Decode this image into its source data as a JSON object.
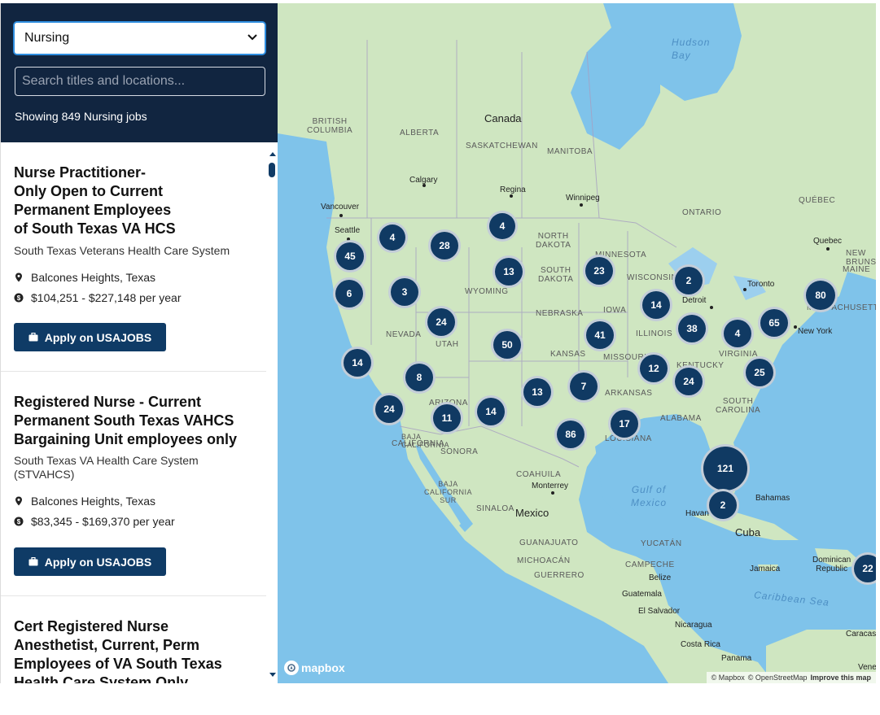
{
  "filters": {
    "category": "Nursing",
    "search_placeholder": "Search titles and locations...",
    "showing_text": "Showing 849 Nursing jobs"
  },
  "jobs": [
    {
      "title": "Nurse Practitioner-\nOnly Open to Current\nPermanent Employees\nof South Texas VA HCS",
      "org": "South Texas Veterans Health Care System",
      "location": "Balcones Heights, Texas",
      "pay": "$104,251 - $227,148 per year",
      "apply": "Apply on USAJOBS"
    },
    {
      "title": "Registered Nurse - Current\nPermanent South Texas VAHCS\nBargaining Unit employees only",
      "org": "South Texas VA Health Care System\n(STVAHCS)",
      "location": "Balcones Heights, Texas",
      "pay": "$83,345 - $169,370 per year",
      "apply": "Apply on USAJOBS"
    },
    {
      "title": "Cert Registered Nurse\nAnesthetist, Current, Perm\nEmployees of VA South Texas\nHealth Care System Only"
    }
  ],
  "map": {
    "clusters": [
      "4",
      "28",
      "4",
      "45",
      "13",
      "23",
      "2",
      "6",
      "3",
      "80",
      "14",
      "24",
      "50",
      "41",
      "38",
      "4",
      "65",
      "14",
      "8",
      "12",
      "24",
      "25",
      "7",
      "13",
      "14",
      "11",
      "24",
      "17",
      "86",
      "121",
      "2",
      "22"
    ],
    "labels": {
      "canada": "Canada",
      "mexico": "Mexico",
      "cuba": "Cuba",
      "hudson_bay": "Hudson\nBay",
      "gulf": "Gulf of\nMexico",
      "caribbean": "Caribbean Sea",
      "british_columbia": "BRITISH\nCOLUMBIA",
      "alberta": "ALBERTA",
      "saskatchewan": "SASKATCHEWAN",
      "manitoba": "MANITOBA",
      "ontario": "ONTARIO",
      "quebec_prov": "QUÉBEC",
      "new_brunswick": "NEW\nBRUNSW",
      "north_dakota": "NORTH\nDAKOTA",
      "south_dakota": "SOUTH\nDAKOTA",
      "minnesota": "MINNESOTA",
      "wisconsin": "WISCONSIN",
      "wyoming": "WYOMING",
      "nebraska": "NEBRASKA",
      "iowa": "IOWA",
      "illinois": "ILLINOIS",
      "nevada": "NEVADA",
      "utah": "UTAH",
      "kansas": "KANSAS",
      "missouri": "MISSOURI",
      "kentucky": "KENTUCKY",
      "virginia": "VIRGINIA",
      "arkansas": "ARKANSAS",
      "arizona": "ARIZONA",
      "california": "CALIFORNIA",
      "louisiana": "LOUISIANA",
      "alabama": "ALABAMA",
      "south_carolina": "SOUTH\nCAROLINA",
      "sonora": "SONORA",
      "coahuila": "COAHUILA",
      "baja_california": "BAJA\nCALIFORNIA",
      "baja_california_sur": "BAJA\nCALIFORNIA\nSUR",
      "sinaloa": "SINALOA",
      "guanajuato": "GUANAJUATO",
      "michoacan": "MICHOACÁN",
      "guerrero": "GUERRERO",
      "yucatan": "YUCATÁN",
      "campeche": "CAMPECHE",
      "maine": "MAINE",
      "massachusetts": "MASSACHUSETTS",
      "calgary": "Calgary",
      "regina": "Regina",
      "winnipeg": "Winnipeg",
      "vancouver": "Vancouver",
      "seattle": "Seattle",
      "toronto": "Toronto",
      "quebec_city": "Quebec",
      "detroit": "Detroit",
      "new_york": "New York",
      "monterrey": "Monterrey",
      "havana": "Havan",
      "bahamas": "Bahamas",
      "jamaica": "Jamaica",
      "dominican": "Dominican\nRepublic",
      "belize": "Belize",
      "guatemala": "Guatemala",
      "el_salvador": "El Salvador",
      "nicaragua": "Nicaragua",
      "costa_rica": "Costa Rica",
      "panama": "Panama",
      "caracas": "Caracas",
      "venez": "Venez"
    },
    "logo": "mapbox",
    "attribution": {
      "mapbox": "© Mapbox",
      "osm": "© OpenStreetMap",
      "improve": "Improve this map"
    },
    "colors": {
      "water": "#7fc3ea",
      "land": "#cfe6c1",
      "cluster": "#103a63"
    }
  }
}
